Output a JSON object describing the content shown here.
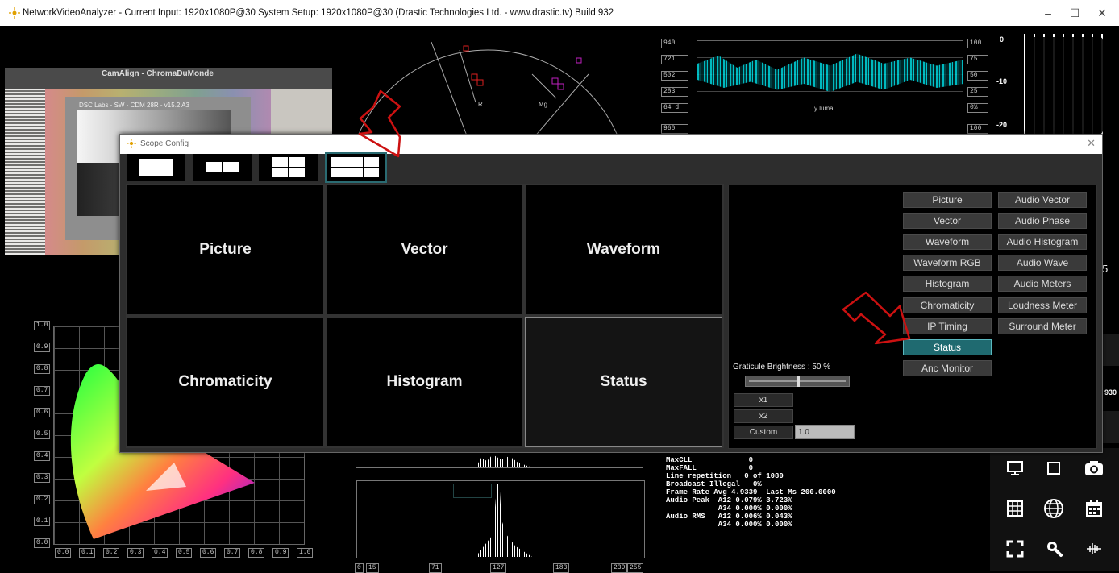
{
  "window": {
    "title": "NetworkVideoAnalyzer - Current Input: 1920x1080P@30  System Setup: 1920x1080P@30   (Drastic Technologies Ltd. - www.drastic.tv) Build 932",
    "minimize": "–",
    "maximize": "☐",
    "close": "✕"
  },
  "picture_panel": {
    "chart_title": "CamAlign - ChromaDuMonde",
    "chart_sub": "DSC Labs - SW - CDM 28R - v15.2 A3"
  },
  "vector_panel": {
    "label_r": "R",
    "label_mg": "Mg"
  },
  "waveform_panel": {
    "left_ticks": [
      "940",
      "721",
      "502",
      "283",
      "64 d"
    ],
    "right_ticks": [
      "100",
      "75",
      "50",
      "25",
      "0%"
    ],
    "channel_label": "y luma",
    "lower_left_tick": "960",
    "lower_right_tick": "100"
  },
  "audio_meter": {
    "scale": [
      "0",
      "-10",
      "-20"
    ]
  },
  "chromaticity_panel": {
    "y_ticks": [
      "1.0",
      "0.9",
      "0.8",
      "0.7",
      "0.6",
      "0.5",
      "0.4",
      "0.3",
      "0.2",
      "0.1",
      "0.0"
    ],
    "x_ticks": [
      "0.0",
      "0.1",
      "0.2",
      "0.3",
      "0.4",
      "0.5",
      "0.6",
      "0.7",
      "0.8",
      "0.9",
      "1.0"
    ]
  },
  "histogram_panel": {
    "x_ticks": [
      "0",
      "15",
      "71",
      "127",
      "183",
      "239",
      "255"
    ]
  },
  "status_panel": {
    "lines": [
      "MaxCLL             0",
      "MaxFALL            0",
      "Line repetition   0 of 1080",
      "Broadcast Illegal   0%",
      "Frame Rate Avg 4.9339  Last Ms 200.0000",
      "Audio Peak  A12 0.079% 3.723%",
      "            A34 0.000% 0.000%",
      "Audio RMS   A12 0.006% 0.043%",
      "            A34 0.000% 0.000%"
    ]
  },
  "partial_texts": {
    "right_five": "5",
    "right_930": "930"
  },
  "toolbar_icons": [
    "monitor-icon",
    "square-icon",
    "camera-icon",
    "grid-icon",
    "globe-icon",
    "calendar-icon",
    "fullscreen-icon",
    "search-icon",
    "audio-wave-icon"
  ],
  "dialog": {
    "title": "Scope Config",
    "close": "✕",
    "layouts": [
      "1x1",
      "2x1",
      "2x2",
      "3x2"
    ],
    "selected_layout": 3,
    "cells": [
      "Picture",
      "Vector",
      "Waveform",
      "Chromaticity",
      "Histogram",
      "Status"
    ],
    "selected_cell": 5,
    "scopes_left": [
      "Picture",
      "Vector",
      "Waveform",
      "Waveform RGB",
      "Histogram",
      "Chromaticity",
      "IP Timing",
      "Status",
      "Anc Monitor"
    ],
    "scopes_right": [
      "Audio Vector",
      "Audio Phase",
      "Audio Histogram",
      "Audio Wave",
      "Audio Meters",
      "Loudness Meter",
      "Surround Meter"
    ],
    "selected_scope": "Status",
    "graticule_label": "Graticule Brightness : 50 %",
    "graticule_value": 0.5,
    "zoom_x1": "x1",
    "zoom_x2": "x2",
    "zoom_custom": "Custom",
    "custom_value": "1.0"
  },
  "colors": {
    "accent": "#1f6a70",
    "arrow": "#cc1111",
    "waveform": "#00e5ee"
  }
}
